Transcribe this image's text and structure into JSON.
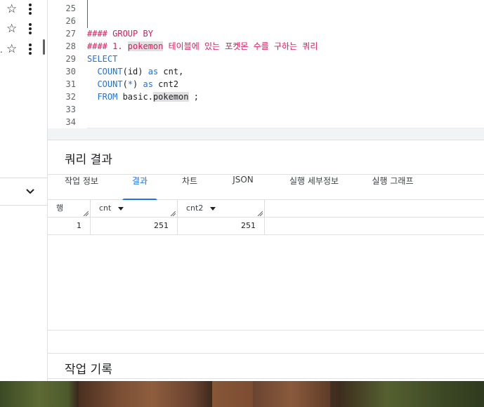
{
  "sidebar": {
    "rows": [
      {
        "prefix": "",
        "star": "☆"
      },
      {
        "prefix": "",
        "star": "☆"
      },
      {
        "prefix": ".",
        "star": "☆"
      }
    ]
  },
  "editor": {
    "lines": [
      {
        "n": "25",
        "tokens": []
      },
      {
        "n": "26",
        "tokens": []
      },
      {
        "n": "27",
        "tokens": [
          {
            "t": "#### GROUP BY",
            "c": "c-comment"
          }
        ]
      },
      {
        "n": "28",
        "tokens": [
          {
            "t": "#### 1. ",
            "c": "c-comment"
          },
          {
            "t": "pokemon",
            "c": "c-comment hl"
          },
          {
            "t": " 테이블에 있는 포켓몬 수를 구하는 쿼리",
            "c": "c-comment"
          }
        ]
      },
      {
        "n": "29",
        "tokens": [
          {
            "t": "SELECT",
            "c": "c-kw"
          }
        ]
      },
      {
        "n": "30",
        "tokens": [
          {
            "t": "  ",
            "c": "c-plain"
          },
          {
            "t": "COUNT",
            "c": "c-fn"
          },
          {
            "t": "(",
            "c": "c-plain"
          },
          {
            "t": "id",
            "c": "c-plain"
          },
          {
            "t": ") ",
            "c": "c-plain"
          },
          {
            "t": "as",
            "c": "c-kw"
          },
          {
            "t": " cnt,",
            "c": "c-plain"
          }
        ]
      },
      {
        "n": "31",
        "tokens": [
          {
            "t": "  ",
            "c": "c-plain"
          },
          {
            "t": "COUNT",
            "c": "c-fn"
          },
          {
            "t": "(",
            "c": "c-plain"
          },
          {
            "t": "*",
            "c": "c-kw"
          },
          {
            "t": ") ",
            "c": "c-plain"
          },
          {
            "t": "as",
            "c": "c-kw"
          },
          {
            "t": " cnt2",
            "c": "c-plain"
          }
        ]
      },
      {
        "n": "32",
        "tokens": [
          {
            "t": "  ",
            "c": "c-plain"
          },
          {
            "t": "FROM",
            "c": "c-kw"
          },
          {
            "t": " basic.",
            "c": "c-plain"
          },
          {
            "t": "pokemon",
            "c": "c-plain hl"
          },
          {
            "t": " ;",
            "c": "c-plain"
          }
        ]
      },
      {
        "n": "33",
        "tokens": []
      },
      {
        "n": "34",
        "tokens": []
      }
    ]
  },
  "results": {
    "title": "쿼리 결과",
    "tabs": [
      "작업 정보",
      "결과",
      "차트",
      "JSON",
      "실행 세부정보",
      "실행 그래프"
    ],
    "active_tab": 1,
    "columns": [
      "행",
      "cnt",
      "cnt2"
    ],
    "rows": [
      [
        "1",
        "251",
        "251"
      ]
    ]
  },
  "history": {
    "title": "작업 기록"
  },
  "colors": {
    "accent": "#1a73e8",
    "comment": "#d81b60",
    "keyword": "#1a73e8"
  }
}
